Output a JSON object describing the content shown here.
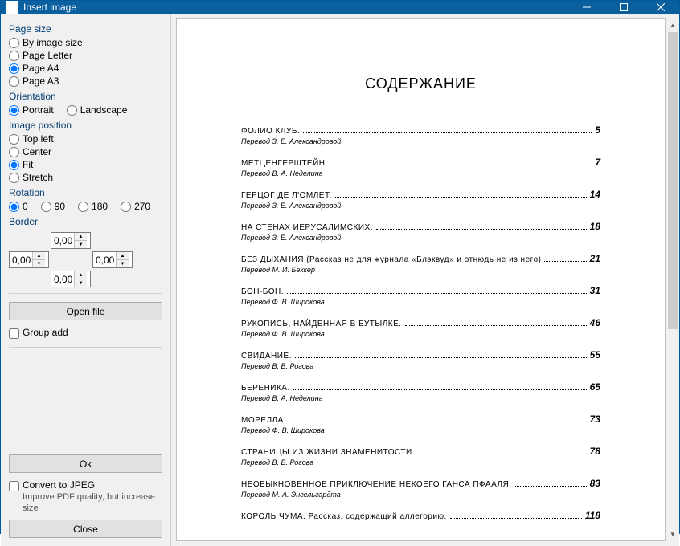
{
  "window": {
    "title": "Insert image"
  },
  "sidebar": {
    "page_size": {
      "label": "Page size",
      "options": [
        "By image size",
        "Page Letter",
        "Page A4",
        "Page A3"
      ],
      "selected": 2
    },
    "orientation": {
      "label": "Orientation",
      "options": [
        "Portrait",
        "Landscape"
      ],
      "selected": 0
    },
    "image_position": {
      "label": "Image position",
      "options": [
        "Top left",
        "Center",
        "Fit",
        "Stretch"
      ],
      "selected": 2
    },
    "rotation": {
      "label": "Rotation",
      "options": [
        "0",
        "90",
        "180",
        "270"
      ],
      "selected": 0
    },
    "border": {
      "label": "Border",
      "top": "0,00",
      "left": "0,00",
      "right": "0,00",
      "bottom": "0,00"
    },
    "open_file": "Open file",
    "group_add": "Group add",
    "ok": "Ok",
    "convert_jpeg": "Convert to JPEG",
    "convert_jpeg_sub": "Improve PDF quality, but increase size",
    "close": "Close"
  },
  "preview": {
    "heading": "СОДЕРЖАНИЕ",
    "toc": [
      {
        "title": "ФОЛИО КЛУБ.",
        "sub": "Перевод З. Е. Александровой",
        "page": "5"
      },
      {
        "title": "МЕТЦЕНГЕРШТЕЙН.",
        "sub": "Перевод В. А. Неделина",
        "page": "7"
      },
      {
        "title": "ГЕРЦОГ ДЕ Л'ОМЛЕТ.",
        "sub": "Перевод З. Е. Александровой",
        "page": "14"
      },
      {
        "title": "НА СТЕНАХ ИЕРУСАЛИМСКИХ.",
        "sub": "Перевод З. Е. Александровой",
        "page": "18"
      },
      {
        "title": "БЕЗ ДЫХАНИЯ (Рассказ не для журнала «Блэквуд» и отнюдь не из него)",
        "sub": "Перевод М. И. Беккер",
        "page": "21"
      },
      {
        "title": "БОН-БОН.",
        "sub": "Перевод Ф. В. Широкова",
        "page": "31"
      },
      {
        "title": "РУКОПИСЬ, НАЙДЕННАЯ В БУТЫЛКЕ.",
        "sub": "Перевод Ф. В. Широкова",
        "page": "46"
      },
      {
        "title": "СВИДАНИЕ.",
        "sub": "Перевод В. В. Рогова",
        "page": "55"
      },
      {
        "title": "БЕРЕНИКА.",
        "sub": "Перевод В. А. Неделина",
        "page": "65"
      },
      {
        "title": "МОРЕЛЛА.",
        "sub": "Перевод Ф. В. Широкова",
        "page": "73"
      },
      {
        "title": "СТРАНИЦЫ ИЗ ЖИЗНИ ЗНАМЕНИТОСТИ.",
        "sub": "Перевод В. В. Рогова",
        "page": "78"
      },
      {
        "title": "НЕОБЫКНОВЕННОЕ ПРИКЛЮЧЕНИЕ НЕКОЕГО ГАНСА ПФААЛЯ.",
        "sub": "Перевод М. А. Энгельгардта",
        "page": "83"
      },
      {
        "title": "КОРОЛЬ ЧУМА. Рассказ, содержащий аллегорию.",
        "sub": "",
        "page": "118"
      }
    ]
  }
}
